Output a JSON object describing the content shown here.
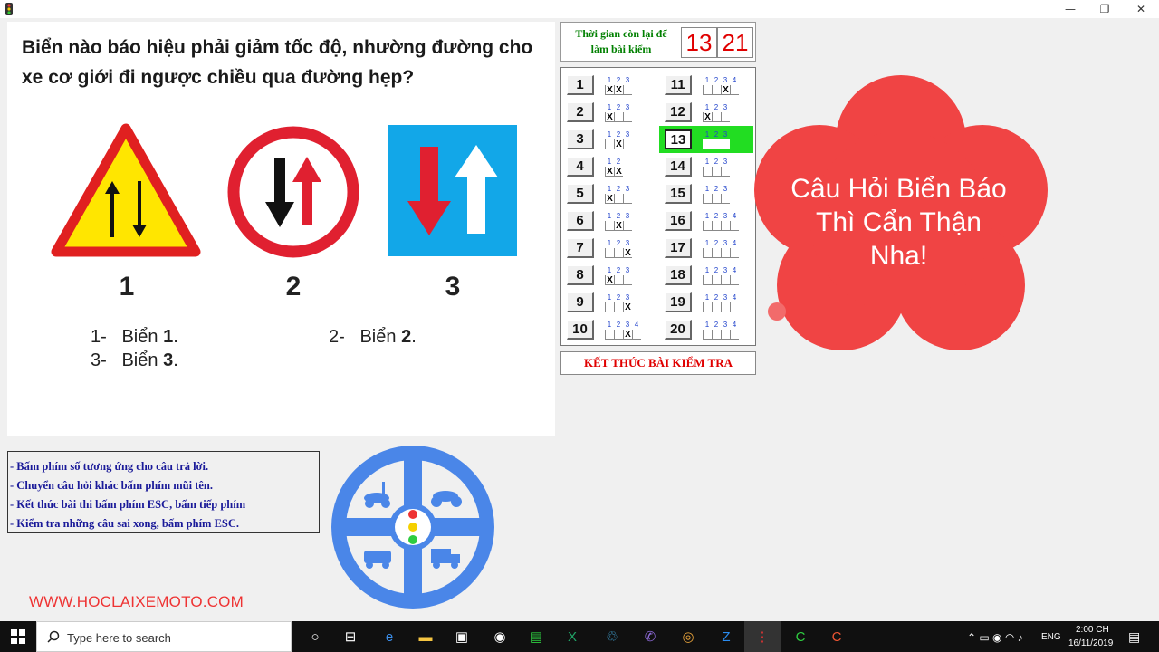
{
  "window": {
    "minimize": "—",
    "maximize": "❐",
    "close": "✕"
  },
  "question": {
    "text": "Biển nào báo hiệu phải giảm tốc độ, nhường đường cho xe cơ giới đi ngược chiều qua đường hẹp?",
    "sign_labels": [
      "1",
      "2",
      "3"
    ],
    "answers": [
      {
        "prefix": "1-",
        "text": "Biển ",
        "bold": "1",
        "suffix": "."
      },
      {
        "prefix": "2-",
        "text": "Biển ",
        "bold": "2",
        "suffix": "."
      },
      {
        "prefix": "3-",
        "text": "Biển ",
        "bold": "3",
        "suffix": "."
      }
    ]
  },
  "timer": {
    "label": "Thời gian còn lại để làm bài kiểm",
    "minutes": "13",
    "seconds": "21"
  },
  "grid": {
    "current": 13,
    "questions": [
      {
        "n": "1",
        "opts": 3,
        "marks": [
          "x",
          "x",
          ""
        ]
      },
      {
        "n": "2",
        "opts": 3,
        "marks": [
          "x",
          "",
          ""
        ]
      },
      {
        "n": "3",
        "opts": 3,
        "marks": [
          "",
          "x",
          ""
        ]
      },
      {
        "n": "4",
        "opts": 2,
        "marks": [
          "x",
          "x"
        ]
      },
      {
        "n": "5",
        "opts": 3,
        "marks": [
          "x",
          "",
          ""
        ]
      },
      {
        "n": "6",
        "opts": 3,
        "marks": [
          "",
          "x",
          ""
        ]
      },
      {
        "n": "7",
        "opts": 3,
        "marks": [
          "",
          "",
          "x"
        ]
      },
      {
        "n": "8",
        "opts": 3,
        "marks": [
          "x",
          "",
          ""
        ]
      },
      {
        "n": "9",
        "opts": 3,
        "marks": [
          "",
          "",
          "x"
        ]
      },
      {
        "n": "10",
        "opts": 4,
        "marks": [
          "",
          "",
          "x",
          ""
        ]
      },
      {
        "n": "11",
        "opts": 4,
        "marks": [
          "",
          "",
          "x",
          ""
        ]
      },
      {
        "n": "12",
        "opts": 3,
        "marks": [
          "x",
          "",
          ""
        ]
      },
      {
        "n": "13",
        "opts": 3,
        "marks": [
          "",
          "",
          ""
        ]
      },
      {
        "n": "14",
        "opts": 3,
        "marks": [
          "",
          "",
          ""
        ]
      },
      {
        "n": "15",
        "opts": 3,
        "marks": [
          "",
          "",
          ""
        ]
      },
      {
        "n": "16",
        "opts": 4,
        "marks": [
          "",
          "",
          "",
          ""
        ]
      },
      {
        "n": "17",
        "opts": 4,
        "marks": [
          "",
          "",
          "",
          ""
        ]
      },
      {
        "n": "18",
        "opts": 4,
        "marks": [
          "",
          "",
          "",
          ""
        ]
      },
      {
        "n": "19",
        "opts": 4,
        "marks": [
          "",
          "",
          "",
          ""
        ]
      },
      {
        "n": "20",
        "opts": 4,
        "marks": [
          "",
          "",
          "",
          ""
        ]
      }
    ]
  },
  "finish_button": "KẾT THÚC BÀI KIỂM TRA",
  "instructions": [
    "- Bấm phím số tương ứng cho câu trả lời.",
    "- Chuyển câu hỏi khác bấm phím mũi tên.",
    "- Kết thúc bài thi bấm phím ESC, bấm tiếp phím",
    "- Kiểm tra những câu sai xong, bấm phím ESC."
  ],
  "website": "WWW.HOCLAIXEMOTO.COM",
  "callout": "Câu Hỏi Biển Báo Thì Cẩn Thận Nha!",
  "colors": {
    "accent_red": "#e00000",
    "timer_green": "#008000",
    "highlight_green": "#22dd22",
    "flower": "#f04444",
    "wheel_blue": "#4a86e8"
  },
  "taskbar": {
    "search_placeholder": "Type here to search",
    "language": "ENG",
    "time": "2:00 CH",
    "date": "16/11/2019",
    "icons": [
      "cortana-icon",
      "task-view-icon",
      "edge-icon",
      "file-explorer-icon",
      "store-icon",
      "camera-icon",
      "notepad-icon",
      "excel-icon",
      "sync-icon",
      "viber-icon",
      "chrome-icon",
      "zalo-icon",
      "traffic-app-icon",
      "camtasia-icon",
      "recorder-icon"
    ]
  }
}
